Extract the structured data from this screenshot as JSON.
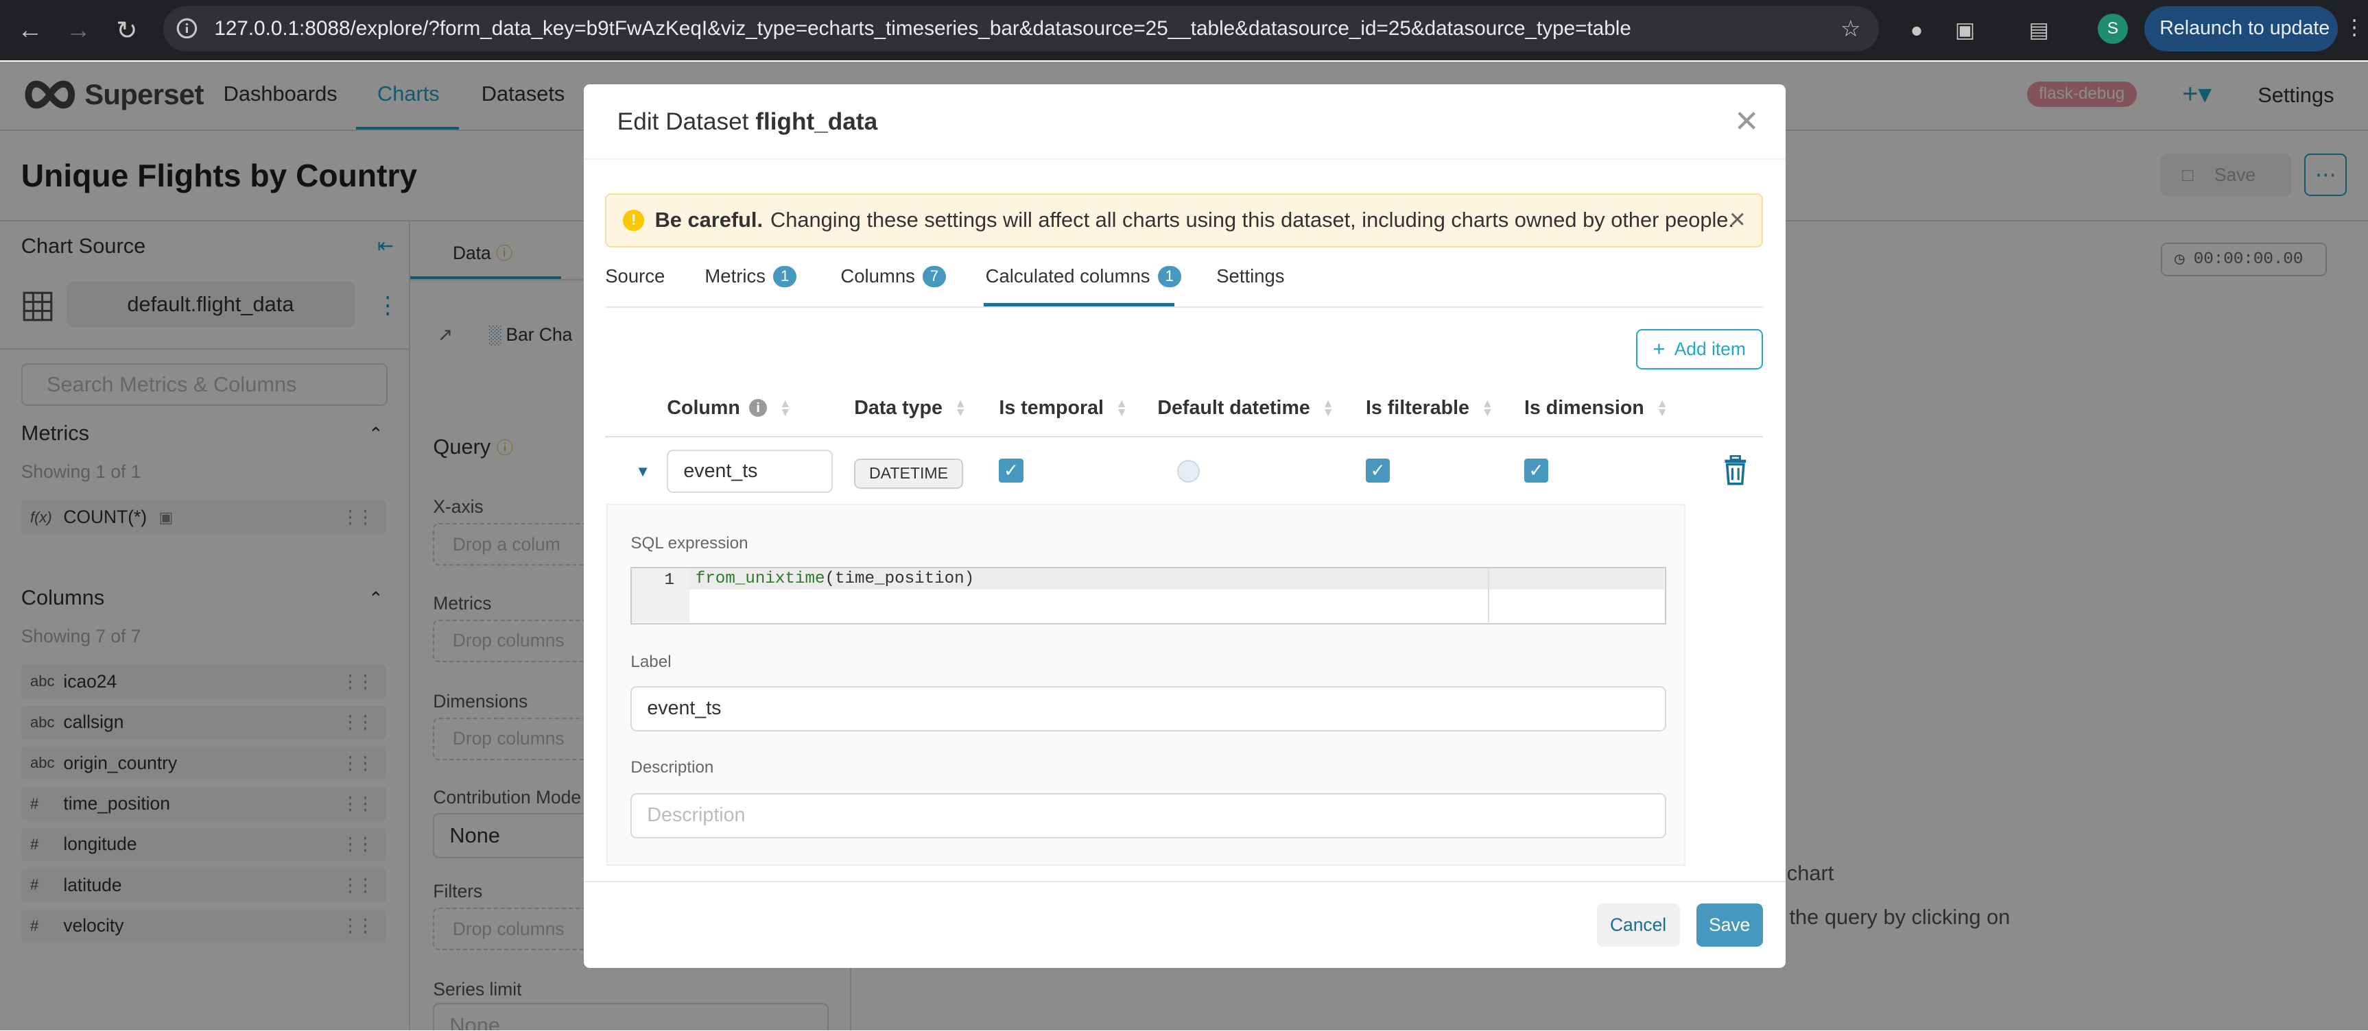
{
  "browser": {
    "url": "127.0.0.1:8088/explore/?form_data_key=b9tFwAzKeqI&viz_type=echarts_timeseries_bar&datasource=25__table&datasource_id=25&datasource_type=table",
    "profile_initial": "S",
    "relaunch_label": "Relaunch to update"
  },
  "app": {
    "logo_text": "Superset",
    "menu": [
      "Dashboards",
      "Charts",
      "Datasets"
    ],
    "env_badge": "flask-debug",
    "settings_label": "Settings"
  },
  "explore": {
    "chart_title": "Unique Flights by Country",
    "save_label": "Save",
    "timer": "00:00:00.00",
    "empty_title": "chart",
    "empty_hint": "n the query by clicking on"
  },
  "left_panel": {
    "title": "Chart Source",
    "datasource": "default.flight_data",
    "search_placeholder": "Search Metrics & Columns",
    "metrics_title": "Metrics",
    "metrics_count": "Showing 1 of 1",
    "metrics": [
      {
        "type": "f(x)",
        "name": "COUNT(*)"
      }
    ],
    "columns_title": "Columns",
    "columns_count": "Showing 7 of 7",
    "columns": [
      {
        "type": "abc",
        "name": "icao24"
      },
      {
        "type": "abc",
        "name": "callsign"
      },
      {
        "type": "abc",
        "name": "origin_country"
      },
      {
        "type": "#",
        "name": "time_position"
      },
      {
        "type": "#",
        "name": "longitude"
      },
      {
        "type": "#",
        "name": "latitude"
      },
      {
        "type": "#",
        "name": "velocity"
      }
    ]
  },
  "middle_panel": {
    "tab": "Data",
    "viz_label": "Bar Cha",
    "query_title": "Query",
    "xaxis_label": "X-axis",
    "xaxis_drop": "Drop a colum",
    "metrics_label": "Metrics",
    "metrics_drop": "Drop columns",
    "dimensions_label": "Dimensions",
    "dimensions_drop": "Drop columns",
    "contribution_label": "Contribution Mode",
    "contribution_value": "None",
    "filters_label": "Filters",
    "filters_drop": "Drop columns",
    "series_limit_label": "Series limit",
    "series_limit_value": "None"
  },
  "modal": {
    "title_prefix": "Edit Dataset",
    "title_dataset": "flight_data",
    "alert_bold": "Be careful.",
    "alert_text": "Changing these settings will affect all charts using this dataset, including charts owned by other people.",
    "tabs": [
      {
        "label": "Source",
        "badge": ""
      },
      {
        "label": "Metrics",
        "badge": "1"
      },
      {
        "label": "Columns",
        "badge": "7"
      },
      {
        "label": "Calculated columns",
        "badge": "1"
      },
      {
        "label": "Settings",
        "badge": ""
      }
    ],
    "add_item_label": "Add item",
    "headers": [
      "Column",
      "Data type",
      "Is temporal",
      "Default datetime",
      "Is filterable",
      "Is dimension"
    ],
    "row": {
      "column_name": "event_ts",
      "data_type": "DATETIME",
      "is_temporal": true,
      "default_datetime": false,
      "is_filterable": true,
      "is_dimension": true
    },
    "sql_label": "SQL expression",
    "sql_line_number": "1",
    "sql_fn": "from_unixtime",
    "sql_arg": "(time_position)",
    "label_label": "Label",
    "label_value": "event_ts",
    "description_label": "Description",
    "description_placeholder": "Description",
    "cancel_label": "Cancel",
    "save_label": "Save"
  },
  "colors": {
    "accent": "#20a7c9",
    "primary_dark": "#1a6d97",
    "badge": "#4698be",
    "alert_bg": "#fdf5e0"
  }
}
